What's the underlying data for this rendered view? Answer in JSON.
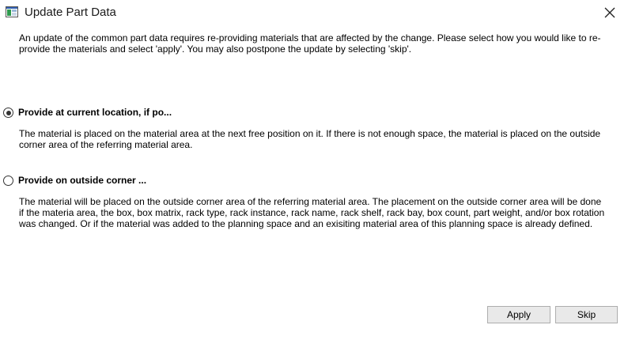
{
  "window": {
    "title": "Update Part Data",
    "icon": "app-window-icon",
    "close_icon": "close-icon"
  },
  "intro": {
    "text": "An update of the common part data requires re-providing materials that are affected by the change. Please select how you would like to re-provide the materials and select 'apply'. You may also postpone the update by selecting 'skip'."
  },
  "options": [
    {
      "label": "Provide at current location, if po...",
      "selected": true,
      "description": "The material is placed on the material area at the next free position on it. If there is not enough space, the material is placed on the outside corner area of the referring material area."
    },
    {
      "label": "Provide on outside corner ...",
      "selected": false,
      "description": "The material will be placed on the outside corner area of the referring material area. The placement on the outside corner area will be done if the materia area, the box, box matrix, rack type, rack instance, rack name, rack shelf, rack bay, box count, part weight, and/or box rotation was changed. Or if the material was added to the planning space and an exisiting material area of this planning space is already defined."
    }
  ],
  "buttons": {
    "apply_label": "Apply",
    "skip_label": "Skip"
  },
  "colors": {
    "window_bg": "#ffffff",
    "button_bg": "#e9e9e9",
    "button_border": "#adadad",
    "icon_green": "#2e9a4e",
    "icon_blue": "#2f5fb3"
  }
}
